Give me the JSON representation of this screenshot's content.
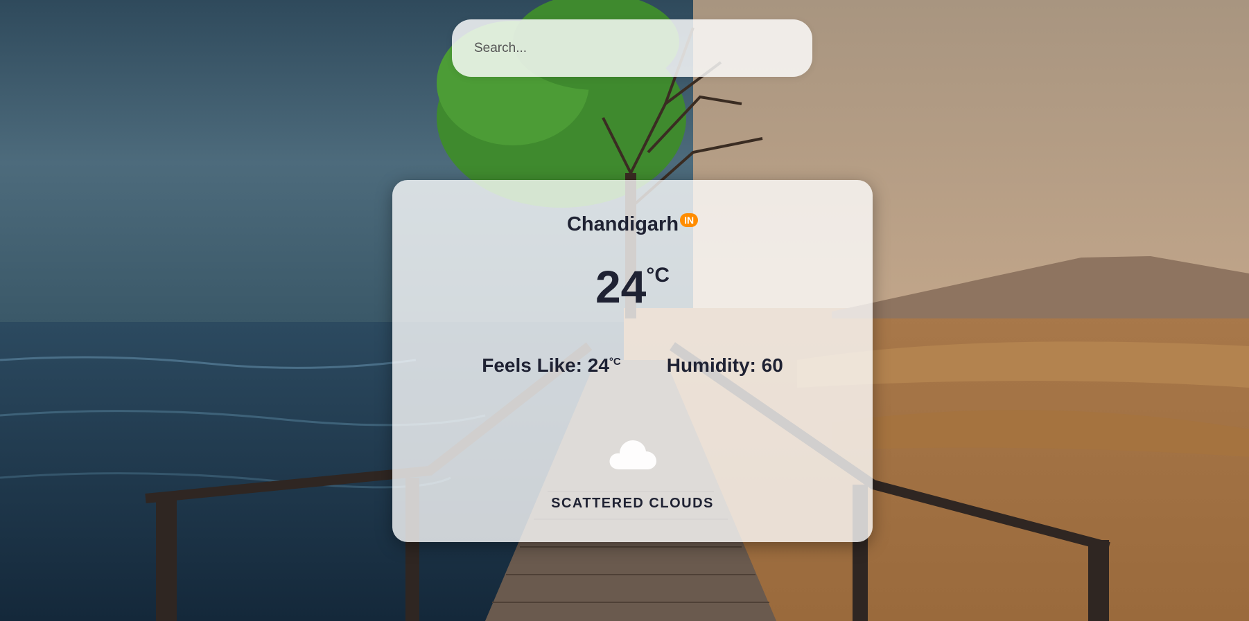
{
  "search": {
    "placeholder": "Search...",
    "value": ""
  },
  "weather": {
    "city": "Chandigarh",
    "country_code": "IN",
    "temperature": "24",
    "temperature_unit": "°C",
    "feels_like_label": "Feels Like: 24",
    "feels_like_unit": "°C",
    "humidity_label": "Humidity: 60",
    "description": "SCATTERED CLOUDS",
    "icon": "cloud-icon"
  },
  "colors": {
    "badge": "#ff8c00",
    "text": "#1f2233",
    "card": "rgba(255,255,255,0.78)"
  }
}
